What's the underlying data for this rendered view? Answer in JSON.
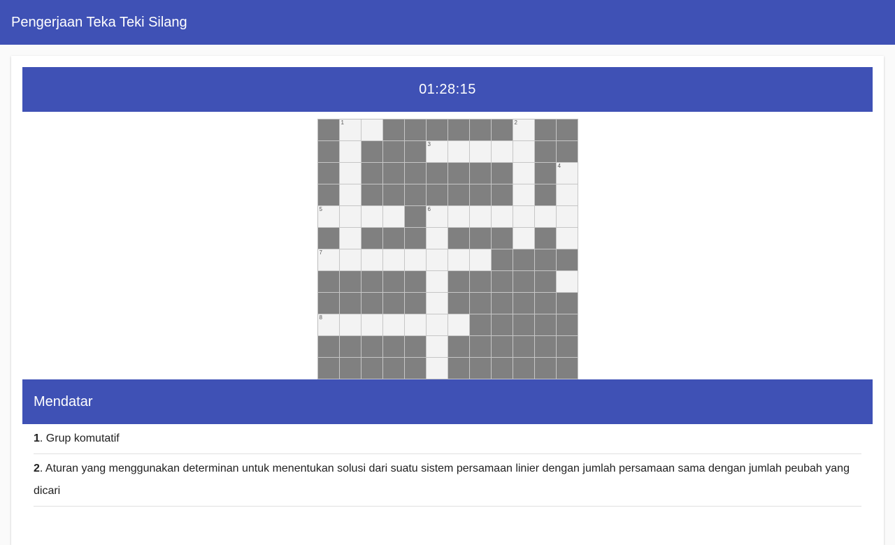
{
  "app": {
    "title": "Pengerjaan Teka Teki Silang"
  },
  "timer": {
    "value": "01:28:15"
  },
  "crossword": {
    "rows": [
      "#..######.##",
      "#.###.....##",
      "#.#######.#.",
      "#.#######.#.",
      "....#.......",
      "#.###.###.#.",
      "........####",
      "#####.#####.",
      "#####.######",
      ".......#####",
      "#####.######",
      "#####.######"
    ],
    "numbers": [
      {
        "n": "1",
        "r": 0,
        "c": 1
      },
      {
        "n": "2",
        "r": 0,
        "c": 9
      },
      {
        "n": "3",
        "r": 1,
        "c": 5
      },
      {
        "n": "4",
        "r": 2,
        "c": 11
      },
      {
        "n": "5",
        "r": 4,
        "c": 0
      },
      {
        "n": "6",
        "r": 4,
        "c": 5
      },
      {
        "n": "7",
        "r": 6,
        "c": 0
      },
      {
        "n": "8",
        "r": 9,
        "c": 0
      }
    ]
  },
  "across": {
    "heading": "Mendatar",
    "clues": [
      {
        "num": "1",
        "text": ". Grup komutatif"
      },
      {
        "num": "2",
        "text": ". Aturan yang menggunakan determinan untuk menentukan solusi dari suatu sistem persamaan linier dengan jumlah persamaan sama dengan jumlah peubah yang dicari"
      }
    ]
  }
}
